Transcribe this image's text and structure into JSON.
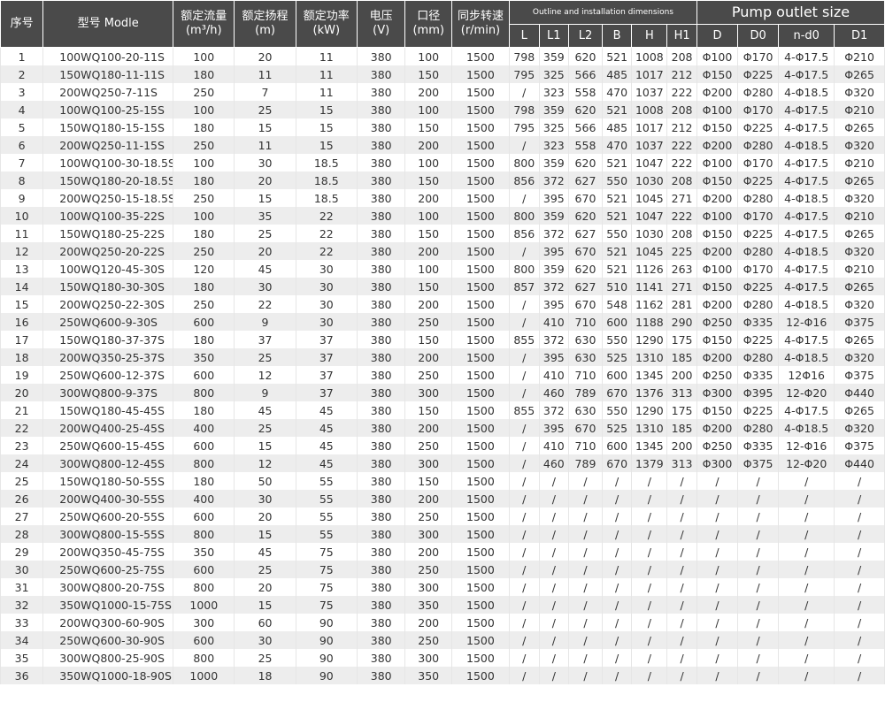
{
  "colors": {
    "header_bg": "#4a4a4a",
    "header_text": "#ffffff",
    "row_alt": "#ededed",
    "text": "#333333"
  },
  "headers": {
    "seq": "序号",
    "model": "型号 Modle",
    "flow": {
      "line1": "额定流量",
      "line2": "(m³/h)"
    },
    "head": {
      "line1": "额定扬程",
      "line2": "(m)"
    },
    "power": {
      "line1": "额定功率",
      "line2": "(kW)"
    },
    "voltage": {
      "line1": "电压",
      "line2": "(V)"
    },
    "caliber": {
      "line1": "口径",
      "line2": "(mm)"
    },
    "speed": {
      "line1": "同步转速",
      "line2": "(r/min)"
    },
    "outline_group": "Outline and installation dimensions",
    "pump_group": "Pump outlet size",
    "outline_cols": [
      "L",
      "L1",
      "L2",
      "B",
      "H",
      "H1"
    ],
    "pump_cols": [
      "D",
      "D0",
      "n-d0",
      "D1"
    ]
  },
  "rows": [
    [
      "1",
      "100WQ100-20-11S",
      "100",
      "20",
      "11",
      "380",
      "100",
      "1500",
      "798",
      "359",
      "620",
      "521",
      "1008",
      "208",
      "Φ100",
      "Φ170",
      "4-Φ17.5",
      "Φ210"
    ],
    [
      "2",
      "150WQ180-11-11S",
      "180",
      "11",
      "11",
      "380",
      "150",
      "1500",
      "795",
      "325",
      "566",
      "485",
      "1017",
      "212",
      "Φ150",
      "Φ225",
      "4-Φ17.5",
      "Φ265"
    ],
    [
      "3",
      "200WQ250-7-11S",
      "250",
      "7",
      "11",
      "380",
      "200",
      "1500",
      "/",
      "323",
      "558",
      "470",
      "1037",
      "222",
      "Φ200",
      "Φ280",
      "4-Φ18.5",
      "Φ320"
    ],
    [
      "4",
      "100WQ100-25-15S",
      "100",
      "25",
      "15",
      "380",
      "100",
      "1500",
      "798",
      "359",
      "620",
      "521",
      "1008",
      "208",
      "Φ100",
      "Φ170",
      "4-Φ17.5",
      "Φ210"
    ],
    [
      "5",
      "150WQ180-15-15S",
      "180",
      "15",
      "15",
      "380",
      "150",
      "1500",
      "795",
      "325",
      "566",
      "485",
      "1017",
      "212",
      "Φ150",
      "Φ225",
      "4-Φ17.5",
      "Φ265"
    ],
    [
      "6",
      "200WQ250-11-15S",
      "250",
      "11",
      "15",
      "380",
      "200",
      "1500",
      "/",
      "323",
      "558",
      "470",
      "1037",
      "222",
      "Φ200",
      "Φ280",
      "4-Φ18.5",
      "Φ320"
    ],
    [
      "7",
      "100WQ100-30-18.5S",
      "100",
      "30",
      "18.5",
      "380",
      "100",
      "1500",
      "800",
      "359",
      "620",
      "521",
      "1047",
      "222",
      "Φ100",
      "Φ170",
      "4-Φ17.5",
      "Φ210"
    ],
    [
      "8",
      "150WQ180-20-18.5S",
      "180",
      "20",
      "18.5",
      "380",
      "150",
      "1500",
      "856",
      "372",
      "627",
      "550",
      "1030",
      "208",
      "Φ150",
      "Φ225",
      "4-Φ17.5",
      "Φ265"
    ],
    [
      "9",
      "200WQ250-15-18.5S",
      "250",
      "15",
      "18.5",
      "380",
      "200",
      "1500",
      "/",
      "395",
      "670",
      "521",
      "1045",
      "271",
      "Φ200",
      "Φ280",
      "4-Φ18.5",
      "Φ320"
    ],
    [
      "10",
      "100WQ100-35-22S",
      "100",
      "35",
      "22",
      "380",
      "100",
      "1500",
      "800",
      "359",
      "620",
      "521",
      "1047",
      "222",
      "Φ100",
      "Φ170",
      "4-Φ17.5",
      "Φ210"
    ],
    [
      "11",
      "150WQ180-25-22S",
      "180",
      "25",
      "22",
      "380",
      "150",
      "1500",
      "856",
      "372",
      "627",
      "550",
      "1030",
      "208",
      "Φ150",
      "Φ225",
      "4-Φ17.5",
      "Φ265"
    ],
    [
      "12",
      "200WQ250-20-22S",
      "250",
      "20",
      "22",
      "380",
      "200",
      "1500",
      "/",
      "395",
      "670",
      "521",
      "1045",
      "225",
      "Φ200",
      "Φ280",
      "4-Φ18.5",
      "Φ320"
    ],
    [
      "13",
      "100WQ120-45-30S",
      "120",
      "45",
      "30",
      "380",
      "100",
      "1500",
      "800",
      "359",
      "620",
      "521",
      "1126",
      "263",
      "Φ100",
      "Φ170",
      "4-Φ17.5",
      "Φ210"
    ],
    [
      "14",
      "150WQ180-30-30S",
      "180",
      "30",
      "30",
      "380",
      "150",
      "1500",
      "857",
      "372",
      "627",
      "510",
      "1141",
      "271",
      "Φ150",
      "Φ225",
      "4-Φ17.5",
      "Φ265"
    ],
    [
      "15",
      "200WQ250-22-30S",
      "250",
      "22",
      "30",
      "380",
      "200",
      "1500",
      "/",
      "395",
      "670",
      "548",
      "1162",
      "281",
      "Φ200",
      "Φ280",
      "4-Φ18.5",
      "Φ320"
    ],
    [
      "16",
      "250WQ600-9-30S",
      "600",
      "9",
      "30",
      "380",
      "250",
      "1500",
      "/",
      "410",
      "710",
      "600",
      "1188",
      "290",
      "Φ250",
      "Φ335",
      "12-Φ16",
      "Φ375"
    ],
    [
      "17",
      "150WQ180-37-37S",
      "180",
      "37",
      "37",
      "380",
      "150",
      "1500",
      "855",
      "372",
      "630",
      "550",
      "1290",
      "175",
      "Φ150",
      "Φ225",
      "4-Φ17.5",
      "Φ265"
    ],
    [
      "18",
      "200WQ350-25-37S",
      "350",
      "25",
      "37",
      "380",
      "200",
      "1500",
      "/",
      "395",
      "630",
      "525",
      "1310",
      "185",
      "Φ200",
      "Φ280",
      "4-Φ18.5",
      "Φ320"
    ],
    [
      "19",
      "250WQ600-12-37S",
      "600",
      "12",
      "37",
      "380",
      "250",
      "1500",
      "/",
      "410",
      "710",
      "600",
      "1345",
      "200",
      "Φ250",
      "Φ335",
      "12Φ16",
      "Φ375"
    ],
    [
      "20",
      "300WQ800-9-37S",
      "800",
      "9",
      "37",
      "380",
      "300",
      "1500",
      "/",
      "460",
      "789",
      "670",
      "1376",
      "313",
      "Φ300",
      "Φ395",
      "12-Φ20",
      "Φ440"
    ],
    [
      "21",
      "150WQ180-45-45S",
      "180",
      "45",
      "45",
      "380",
      "150",
      "1500",
      "855",
      "372",
      "630",
      "550",
      "1290",
      "175",
      "Φ150",
      "Φ225",
      "4-Φ17.5",
      "Φ265"
    ],
    [
      "22",
      "200WQ400-25-45S",
      "400",
      "25",
      "45",
      "380",
      "200",
      "1500",
      "/",
      "395",
      "670",
      "525",
      "1310",
      "185",
      "Φ200",
      "Φ280",
      "4-Φ18.5",
      "Φ320"
    ],
    [
      "23",
      "250WQ600-15-45S",
      "600",
      "15",
      "45",
      "380",
      "250",
      "1500",
      "/",
      "410",
      "710",
      "600",
      "1345",
      "200",
      "Φ250",
      "Φ335",
      "12-Φ16",
      "Φ375"
    ],
    [
      "24",
      "300WQ800-12-45S",
      "800",
      "12",
      "45",
      "380",
      "300",
      "1500",
      "/",
      "460",
      "789",
      "670",
      "1379",
      "313",
      "Φ300",
      "Φ375",
      "12-Φ20",
      "Φ440"
    ],
    [
      "25",
      "150WQ180-50-55S",
      "180",
      "50",
      "55",
      "380",
      "150",
      "1500",
      "/",
      "/",
      "/",
      "/",
      "/",
      "/",
      "/",
      "/",
      "/",
      "/"
    ],
    [
      "26",
      "200WQ400-30-55S",
      "400",
      "30",
      "55",
      "380",
      "200",
      "1500",
      "/",
      "/",
      "/",
      "/",
      "/",
      "/",
      "/",
      "/",
      "/",
      "/"
    ],
    [
      "27",
      "250WQ600-20-55S",
      "600",
      "20",
      "55",
      "380",
      "250",
      "1500",
      "/",
      "/",
      "/",
      "/",
      "/",
      "/",
      "/",
      "/",
      "/",
      "/"
    ],
    [
      "28",
      "300WQ800-15-55S",
      "800",
      "15",
      "55",
      "380",
      "300",
      "1500",
      "/",
      "/",
      "/",
      "/",
      "/",
      "/",
      "/",
      "/",
      "/",
      "/"
    ],
    [
      "29",
      "200WQ350-45-75S",
      "350",
      "45",
      "75",
      "380",
      "200",
      "1500",
      "/",
      "/",
      "/",
      "/",
      "/",
      "/",
      "/",
      "/",
      "/",
      "/"
    ],
    [
      "30",
      "250WQ600-25-75S",
      "600",
      "25",
      "75",
      "380",
      "250",
      "1500",
      "/",
      "/",
      "/",
      "/",
      "/",
      "/",
      "/",
      "/",
      "/",
      "/"
    ],
    [
      "31",
      "300WQ800-20-75S",
      "800",
      "20",
      "75",
      "380",
      "300",
      "1500",
      "/",
      "/",
      "/",
      "/",
      "/",
      "/",
      "/",
      "/",
      "/",
      "/"
    ],
    [
      "32",
      "350WQ1000-15-75S",
      "1000",
      "15",
      "75",
      "380",
      "350",
      "1500",
      "/",
      "/",
      "/",
      "/",
      "/",
      "/",
      "/",
      "/",
      "/",
      "/"
    ],
    [
      "33",
      "200WQ300-60-90S",
      "300",
      "60",
      "90",
      "380",
      "200",
      "1500",
      "/",
      "/",
      "/",
      "/",
      "/",
      "/",
      "/",
      "/",
      "/",
      "/"
    ],
    [
      "34",
      "250WQ600-30-90S",
      "600",
      "30",
      "90",
      "380",
      "250",
      "1500",
      "/",
      "/",
      "/",
      "/",
      "/",
      "/",
      "/",
      "/",
      "/",
      "/"
    ],
    [
      "35",
      "300WQ800-25-90S",
      "800",
      "25",
      "90",
      "380",
      "300",
      "1500",
      "/",
      "/",
      "/",
      "/",
      "/",
      "/",
      "/",
      "/",
      "/",
      "/"
    ],
    [
      "36",
      "350WQ1000-18-90S",
      "1000",
      "18",
      "90",
      "380",
      "350",
      "1500",
      "/",
      "/",
      "/",
      "/",
      "/",
      "/",
      "/",
      "/",
      "/",
      "/"
    ]
  ]
}
